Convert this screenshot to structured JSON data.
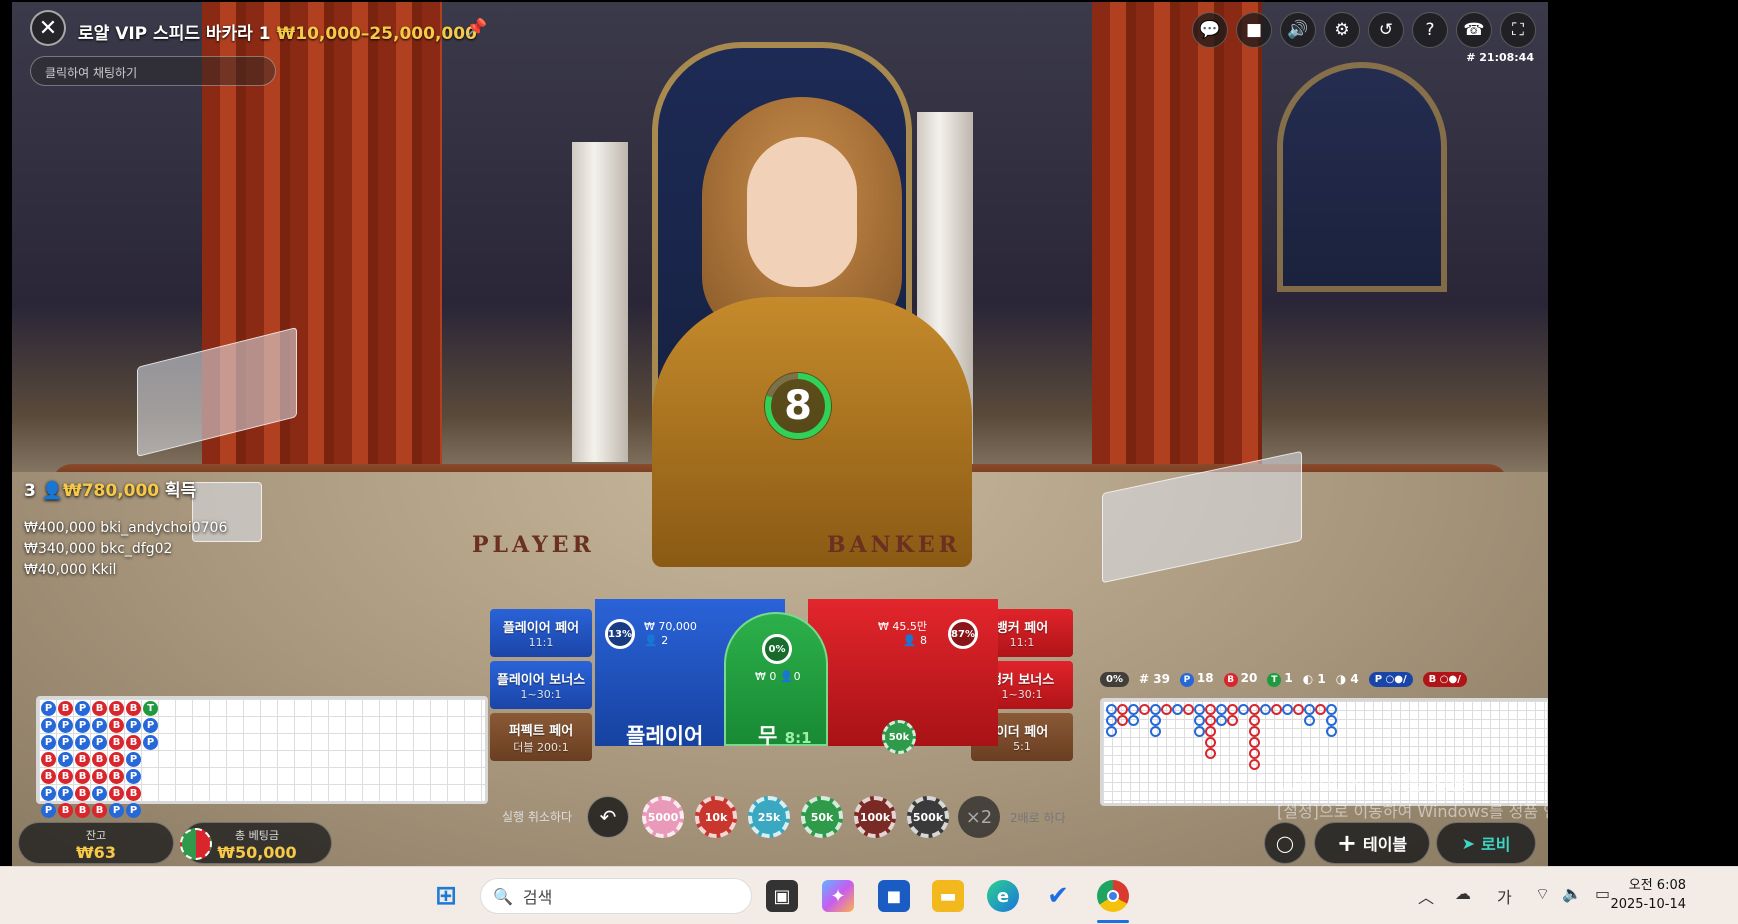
{
  "header": {
    "title": "로얄 VIP 스피드 바카라 1",
    "limits": "₩10,000–25,000,000",
    "chat_placeholder": "클릭하여 채팅하기",
    "game_id": "# 21:08:44"
  },
  "top_icons": [
    "chat-icon",
    "video-icon",
    "volume-icon",
    "settings-icon",
    "history-icon",
    "help-icon",
    "support-icon",
    "fullscreen-icon"
  ],
  "timer": {
    "value": "8",
    "progress": 0.8
  },
  "winners": {
    "count": "3",
    "total": "₩780,000",
    "label": "획득",
    "rows": [
      {
        "amount": "₩400,000",
        "name": "bki_andychoi0706"
      },
      {
        "amount": "₩340,000",
        "name": "bkc_dfg02"
      },
      {
        "amount": "₩40,000",
        "name": "Kkil"
      }
    ]
  },
  "bets": {
    "player_pair": {
      "label": "플레이어 페어",
      "odds": "11:1"
    },
    "player_bonus": {
      "label": "플레이어 보너스",
      "odds": "1~30:1"
    },
    "perfect_pair": {
      "label": "퍼펙트 페어",
      "odds": "더블 200:1"
    },
    "banker_pair": {
      "label": "뱅커 페어",
      "odds": "11:1"
    },
    "banker_bonus": {
      "label": "뱅커 보너스",
      "odds": "1~30:1"
    },
    "either_pair": {
      "label": "이더 페어",
      "odds": "5:1"
    },
    "player": {
      "label": "플레이어",
      "pct": "13%",
      "amount": "₩ 70,000",
      "players": "2"
    },
    "tie": {
      "label": "무",
      "odds": "8:1",
      "pct": "0%",
      "amount": "₩ 0",
      "players": "0"
    },
    "banker": {
      "pct": "87%",
      "amount": "₩ 45.5만",
      "players": "8",
      "chip": "50k"
    }
  },
  "chips": {
    "undo_label": "실행 취소하다",
    "values": [
      "5000",
      "10k",
      "25k",
      "50k",
      "100k",
      "500k"
    ],
    "colors": [
      "#e89ab8",
      "#c8362e",
      "#3aa8c0",
      "#2f9a4a",
      "#7a2a24",
      "#3a3a3a"
    ],
    "double": "×2",
    "double_label": "2배로 하다"
  },
  "balance": {
    "label": "잔고",
    "value": "₩63"
  },
  "total_bet": {
    "label": "총 베팅금",
    "value": "₩50,000"
  },
  "bead_road": [
    [
      "P",
      "P",
      "P",
      "B",
      "B",
      "P",
      "P"
    ],
    [
      "B",
      "P",
      "P",
      "P",
      "B",
      "P",
      "B"
    ],
    [
      "P",
      "P",
      "P",
      "B",
      "B",
      "B",
      "B"
    ],
    [
      "B",
      "P",
      "P",
      "B",
      "B",
      "P",
      "B"
    ],
    [
      "B",
      "B",
      "B",
      "B",
      "B",
      "B",
      "P"
    ],
    [
      "B",
      "P",
      "B",
      "P",
      "P",
      "B",
      "P"
    ],
    [
      "T",
      "P",
      "P",
      "",
      "",
      "",
      ""
    ]
  ],
  "stats": {
    "pct": "0%",
    "round": "# 39",
    "player": "18",
    "banker": "20",
    "tie": "1",
    "p_pair": "1",
    "b_pair": "4",
    "p_label": "P",
    "b_label": "B",
    "t_label": "T"
  },
  "buttons": {
    "table": "테이블",
    "lobby": "로비"
  },
  "watermark": {
    "line1": "Windows 정품 인증",
    "line2": "[설정]으로 이동하여 Windows를 정품 인증합니다."
  },
  "taskbar": {
    "search": "검색",
    "time": "오전 6:08",
    "date": "2025-10-14",
    "ime": "가"
  }
}
